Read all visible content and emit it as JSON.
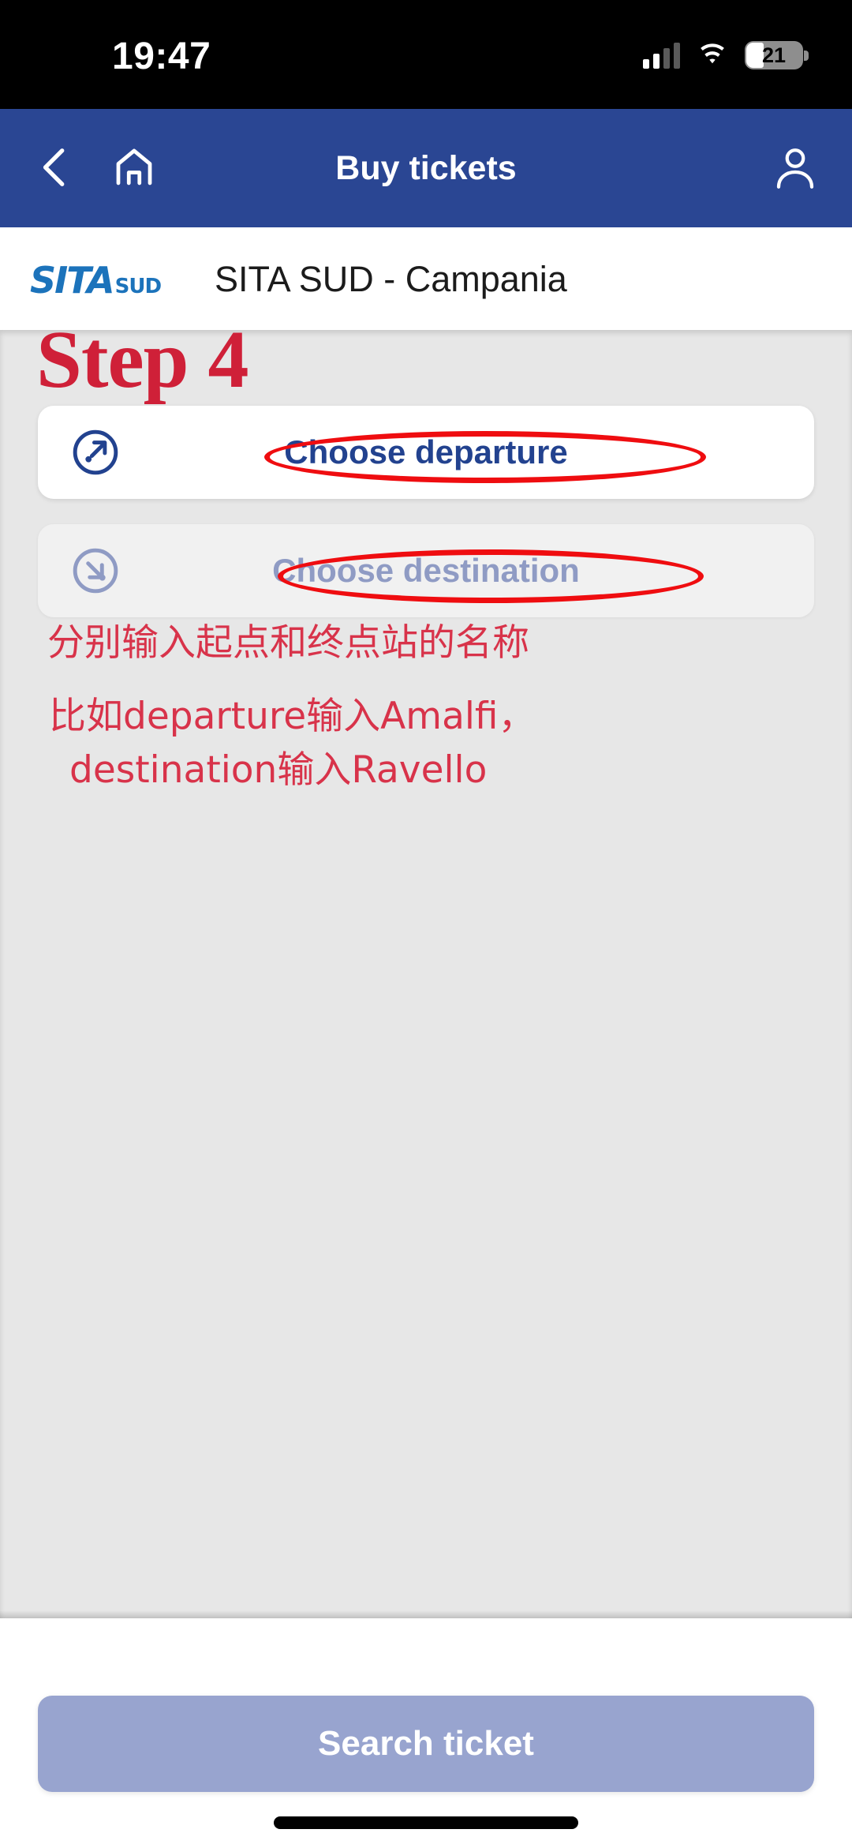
{
  "status_bar": {
    "time": "19:47",
    "battery_percent": "21",
    "signal_icon": "cellular-signal-icon",
    "wifi_icon": "wifi-icon",
    "battery_icon": "battery-icon"
  },
  "app_bar": {
    "title": "Buy tickets",
    "back_icon": "back-chevron-icon",
    "home_icon": "home-icon",
    "account_icon": "account-person-icon",
    "background_color": "#2a4693"
  },
  "brand": {
    "logo_primary": "SITA",
    "logo_secondary": "SUD",
    "logo_color": "#1c73bb",
    "operator_name": "SITA SUD - Campania"
  },
  "form": {
    "departure": {
      "label": "Choose departure",
      "icon": "arrow-up-right-circle-icon",
      "value": "",
      "text_color": "#22428f",
      "background_color": "#ffffff"
    },
    "destination": {
      "label": "Choose destination",
      "icon": "arrow-down-right-circle-icon",
      "value": "",
      "text_color": "#8f9bc4",
      "background_color": "#f1f1f1"
    }
  },
  "footer": {
    "search_button_label": "Search ticket",
    "search_button_color": "#98a4cf"
  },
  "annotations": {
    "step_label": "Step 4",
    "step_color": "#cf2038",
    "note_line_1": "分别输入起点和终点站的名称",
    "note_line_2a": "比如departure输入Amalfi，",
    "note_line_2b": "destination输入Ravello",
    "note_color": "#d8334a",
    "highlight_color": "#ef0d10",
    "highlight_departure": "ellipse-around-choose-departure",
    "highlight_destination": "ellipse-around-choose-destination"
  }
}
